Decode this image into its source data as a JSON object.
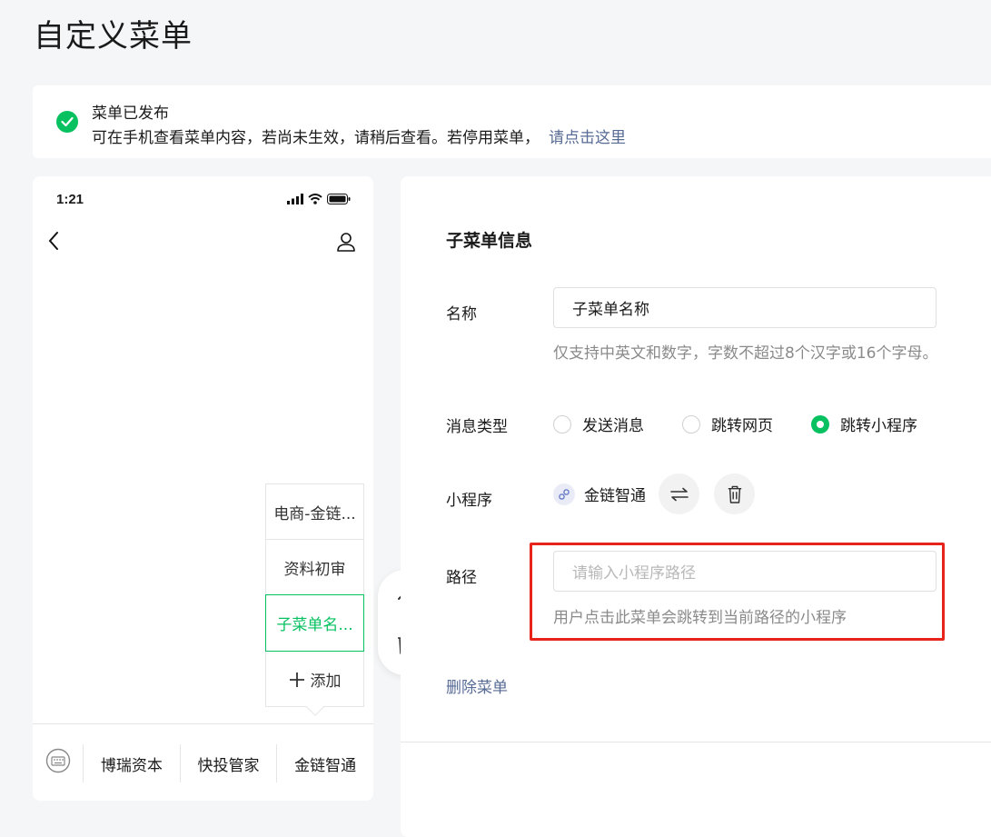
{
  "page": {
    "title": "自定义菜单"
  },
  "banner": {
    "title": "菜单已发布",
    "description": "可在手机查看菜单内容，若尚未生效，请稍后查看。若停用菜单，",
    "link": "请点击这里"
  },
  "phone": {
    "time": "1:21",
    "submenu": {
      "items": [
        "电商-金链...",
        "资料初审",
        "子菜单名..."
      ],
      "add_label": "添加"
    },
    "tabs": [
      "博瑞资本",
      "快投管家",
      "金链智通"
    ]
  },
  "panel": {
    "title": "子菜单信息",
    "name": {
      "label": "名称",
      "value": "子菜单名称",
      "hint": "仅支持中英文和数字，字数不超过8个汉字或16个字母。"
    },
    "msg_type": {
      "label": "消息类型",
      "options": [
        "发送消息",
        "跳转网页",
        "跳转小程序"
      ],
      "selected_index": 2
    },
    "miniprogram": {
      "label": "小程序",
      "name": "金链智通"
    },
    "path": {
      "label": "路径",
      "placeholder": "请输入小程序路径",
      "hint": "用户点击此菜单会跳转到当前路径的小程序"
    },
    "delete_label": "删除菜单"
  },
  "colors": {
    "accent": "#07c160",
    "link": "#576b95",
    "highlight": "#e8231a"
  }
}
